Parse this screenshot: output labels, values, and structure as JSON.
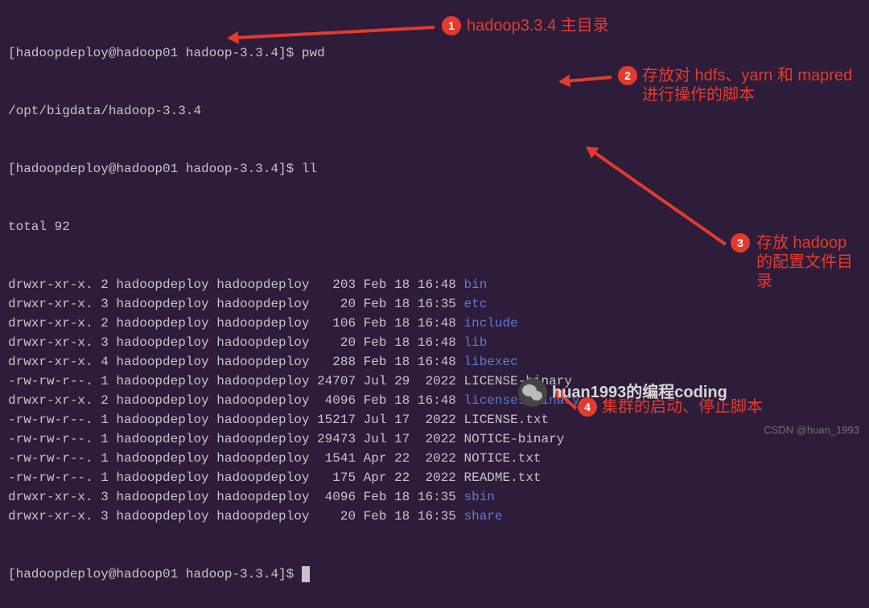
{
  "prompt": "[hadoopdeploy@hadoop01 hadoop-3.3.4]$ ",
  "commands": {
    "pwd": "pwd",
    "pwd_output": "/opt/bigdata/hadoop-3.3.4",
    "ll": "ll",
    "total": "total 92"
  },
  "listing": [
    {
      "perm": "drwxr-xr-x. 2 hadoopdeploy hadoopdeploy   203 Feb 18 16:48 ",
      "name": "bin",
      "dir": true
    },
    {
      "perm": "drwxr-xr-x. 3 hadoopdeploy hadoopdeploy    20 Feb 18 16:35 ",
      "name": "etc",
      "dir": true
    },
    {
      "perm": "drwxr-xr-x. 2 hadoopdeploy hadoopdeploy   106 Feb 18 16:48 ",
      "name": "include",
      "dir": true
    },
    {
      "perm": "drwxr-xr-x. 3 hadoopdeploy hadoopdeploy    20 Feb 18 16:48 ",
      "name": "lib",
      "dir": true
    },
    {
      "perm": "drwxr-xr-x. 4 hadoopdeploy hadoopdeploy   288 Feb 18 16:48 ",
      "name": "libexec",
      "dir": true
    },
    {
      "perm": "-rw-rw-r--. 1 hadoopdeploy hadoopdeploy 24707 Jul 29  2022 ",
      "name": "LICENSE-binary",
      "dir": false
    },
    {
      "perm": "drwxr-xr-x. 2 hadoopdeploy hadoopdeploy  4096 Feb 18 16:48 ",
      "name": "licenses-binary",
      "dir": true
    },
    {
      "perm": "-rw-rw-r--. 1 hadoopdeploy hadoopdeploy 15217 Jul 17  2022 ",
      "name": "LICENSE.txt",
      "dir": false
    },
    {
      "perm": "-rw-rw-r--. 1 hadoopdeploy hadoopdeploy 29473 Jul 17  2022 ",
      "name": "NOTICE-binary",
      "dir": false
    },
    {
      "perm": "-rw-rw-r--. 1 hadoopdeploy hadoopdeploy  1541 Apr 22  2022 ",
      "name": "NOTICE.txt",
      "dir": false
    },
    {
      "perm": "-rw-rw-r--. 1 hadoopdeploy hadoopdeploy   175 Apr 22  2022 ",
      "name": "README.txt",
      "dir": false
    },
    {
      "perm": "drwxr-xr-x. 3 hadoopdeploy hadoopdeploy  4096 Feb 18 16:35 ",
      "name": "sbin",
      "dir": true
    },
    {
      "perm": "drwxr-xr-x. 3 hadoopdeploy hadoopdeploy    20 Feb 18 16:35 ",
      "name": "share",
      "dir": true
    }
  ],
  "annotations": {
    "b1": "1",
    "a1": "hadoop3.3.4 主目录",
    "b2": "2",
    "a2": "存放对 hdfs、yarn 和 mapred 进行操作的脚本",
    "b3": "3",
    "a3": "存放 hadoop 的配置文件目录",
    "b4": "4",
    "a4": "集群的启动、停止脚本"
  },
  "watermark": "huan1993的编程coding",
  "csdn": "CSDN @huan_1993"
}
